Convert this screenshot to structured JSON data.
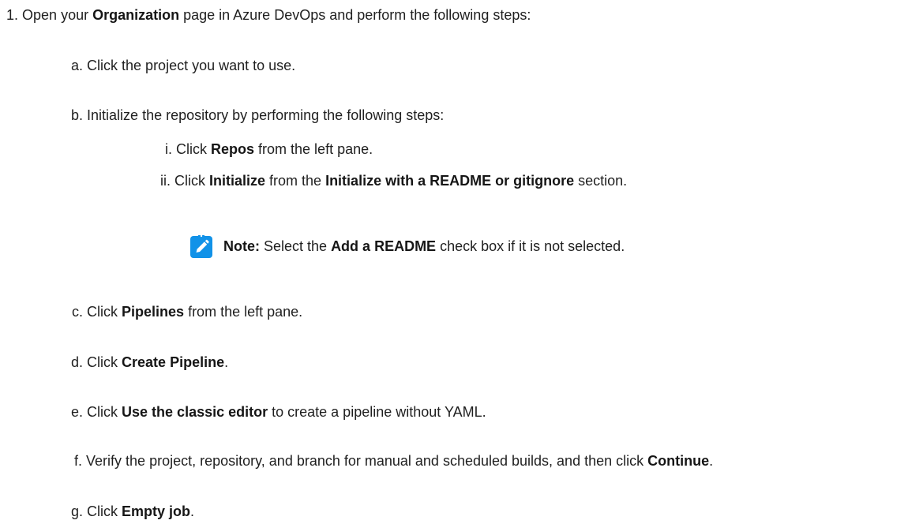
{
  "step1": {
    "num": "1.",
    "t1": "Open your ",
    "b1": "Organization",
    "t2": " page in Azure DevOps and perform the following steps:"
  },
  "a": {
    "marker": "a.",
    "text": "Click the project you want to use."
  },
  "b": {
    "marker": "b.",
    "text": "Initialize the repository by performing the following steps:"
  },
  "bi": {
    "marker": "i.",
    "t1": "Click ",
    "b1": "Repos",
    "t2": " from the left pane."
  },
  "bii": {
    "marker": "ii.",
    "t1": "Click ",
    "b1": "Initialize",
    "t2": " from the ",
    "b2": "Initialize with a README or gitignore",
    "t3": " section."
  },
  "note": {
    "icon": "pencil-note-icon",
    "icon_color": "#1192e8",
    "label": "Note:",
    "t1": " Select the ",
    "b1": "Add a README",
    "t2": " check box if it is not selected."
  },
  "c": {
    "marker": "c.",
    "t1": "Click ",
    "b1": "Pipelines",
    "t2": " from the left pane."
  },
  "d": {
    "marker": "d.",
    "t1": "Click ",
    "b1": "Create Pipeline",
    "t2": "."
  },
  "e": {
    "marker": "e.",
    "t1": "Click ",
    "b1": "Use the classic editor",
    "t2": " to create a pipeline without YAML."
  },
  "f": {
    "marker": "f.",
    "t1": "Verify the project, repository, and branch for manual and scheduled builds, and then click ",
    "b1": "Continue",
    "t2": "."
  },
  "g": {
    "marker": "g.",
    "t1": "Click ",
    "b1": "Empty job",
    "t2": "."
  }
}
